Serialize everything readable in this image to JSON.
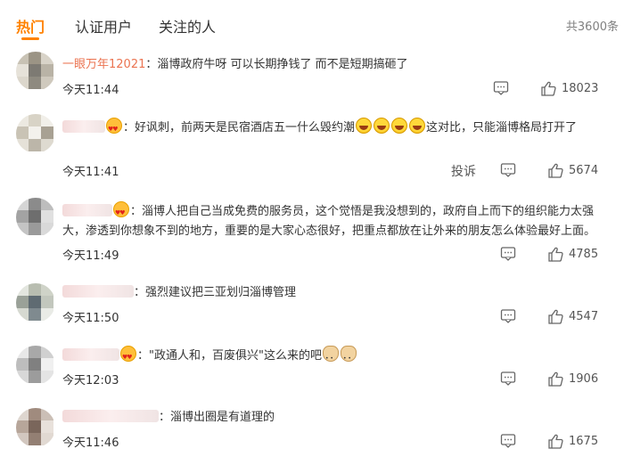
{
  "tabs": {
    "hot": "热门",
    "verified": "认证用户",
    "following": "关注的人"
  },
  "total_count": "共3600条",
  "actions": {
    "report": "投诉"
  },
  "colors": {
    "accent": "#ff8200",
    "username": "#eb7350"
  },
  "icons": {
    "reply": "comment-icon",
    "like": "thumb-up-icon"
  },
  "comments": [
    {
      "username": "一眼万年12021",
      "text": "：淄博政府牛呀 可以长期挣钱了 而不是短期搞砸了",
      "time": "今天11:44",
      "likes": "18023"
    },
    {
      "username": "",
      "text": "：好讽刺，前两天是民宿酒店五一什么毁约潮",
      "text_tail": "这对比，只能淄博格局打开了",
      "time": "今天11:41",
      "likes": "5674"
    },
    {
      "username": "",
      "text": "：淄博人把自己当成免费的服务员，这个觉悟是我没想到的，政府自上而下的组织能力太强大，渗透到你想象不到的地方，重要的是大家心态很好，把重点都放在让外来的朋友怎么体验最好上面。",
      "time": "今天11:49",
      "likes": "4785"
    },
    {
      "username": "",
      "text": "：强烈建议把三亚划归淄博管理",
      "time": "今天11:50",
      "likes": "4547"
    },
    {
      "username": "",
      "text": "：\"政通人和，百废俱兴\"这么来的吧",
      "time": "今天12:03",
      "likes": "1906"
    },
    {
      "username": "",
      "text": "：淄博出圈是有道理的",
      "time": "今天11:46",
      "likes": "1675"
    }
  ]
}
